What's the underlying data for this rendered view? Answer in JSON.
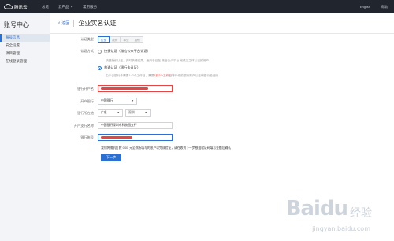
{
  "topbar": {
    "brand": "腾讯云",
    "nav": [
      {
        "label": "总览",
        "caret": false
      },
      {
        "label": "云产品",
        "caret": true
      },
      {
        "label": "常用服务",
        "caret": false
      }
    ],
    "right": [
      "English",
      "帮助"
    ]
  },
  "sidebar": {
    "title": "账号中心",
    "items": [
      {
        "label": "账号信息",
        "active": true
      },
      {
        "label": "安全设置",
        "active": false
      },
      {
        "label": "项目管理",
        "active": false
      },
      {
        "label": "在线登录管理",
        "active": false
      }
    ]
  },
  "header": {
    "back_label": "返回",
    "title": "企业实名认证"
  },
  "form": {
    "type_label": "认证类型",
    "types": [
      {
        "label": "企业",
        "selected": true
      },
      {
        "label": "政府",
        "selected": false
      },
      {
        "label": "事业",
        "selected": false
      },
      {
        "label": "其他",
        "selected": false
      }
    ],
    "method_label": "认证方式",
    "method_options": [
      {
        "label": "快捷认证（微信公众平台认证）",
        "selected": false,
        "desc": "快捷授权认证，实时获得结果，适用于已在 微信公众平台 完成过主体认证的用户"
      },
      {
        "label": "普通认证（银行卡认证）",
        "selected": true,
        "desc_before": "由于该银行卡需要1~2个工作日，需要",
        "desc_highlight": "1到2个工作日",
        "desc_after": "等待你的银行账户认证和银行验证码"
      }
    ],
    "bank_account_name_label": "银行开户名",
    "bank_label": "开户银行",
    "bank_value": "中国银行",
    "region_label": "银行所在地",
    "province_value": "广东",
    "city_value": "深圳",
    "branch_label": "开户支行名称",
    "branch_value": "中国银行深圳市科技园支行",
    "account_number_label": "银行账号",
    "note": "我们将随机打款 0.01 元至你所填写的账户以完成验证，请在收到下一步根据验证码填写金额后确认",
    "next_button": "下一步"
  },
  "watermark": {
    "brand": "Baidu",
    "sub": "经验",
    "url": "jingyan.baidu.com"
  },
  "colors": {
    "accent": "#2b6fd0",
    "topbar": "#21262e",
    "error": "#e54545"
  }
}
